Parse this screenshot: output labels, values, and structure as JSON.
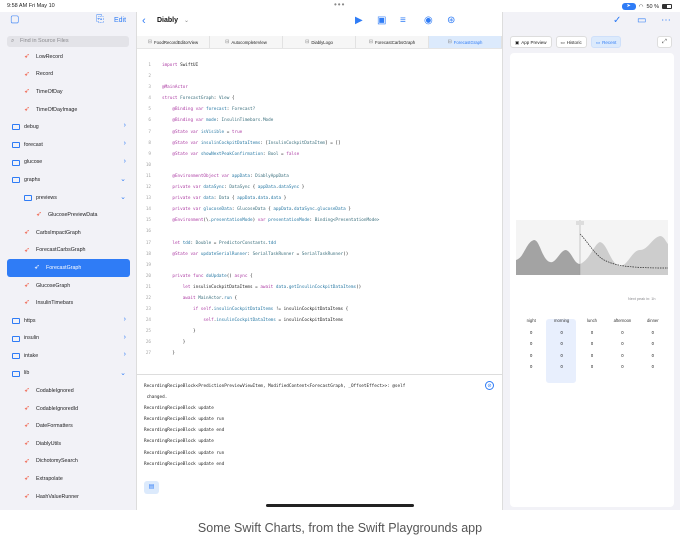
{
  "status_bar": {
    "time": "9:58 AM   Fri May 10",
    "battery": "50 %"
  },
  "sidebar": {
    "edit_label": "Edit",
    "search_placeholder": "Find in Source Files",
    "items": [
      {
        "label": "LowRecord",
        "type": "swift",
        "indent": 1
      },
      {
        "label": "Record",
        "type": "swift",
        "indent": 1
      },
      {
        "label": "TimeOfDay",
        "type": "swift",
        "indent": 1
      },
      {
        "label": "TimeOfDayImage",
        "type": "swift",
        "indent": 1
      },
      {
        "label": "debug",
        "type": "folder",
        "indent": 0,
        "chevron": "›"
      },
      {
        "label": "forecast",
        "type": "folder",
        "indent": 0,
        "chevron": "›"
      },
      {
        "label": "glucose",
        "type": "folder",
        "indent": 0,
        "chevron": "›"
      },
      {
        "label": "graphs",
        "type": "folder",
        "indent": 0,
        "chevron": "⌄"
      },
      {
        "label": "previews",
        "type": "folder",
        "indent": 1,
        "chevron": "⌄"
      },
      {
        "label": "GlucosePreviewData",
        "type": "swift",
        "indent": 2
      },
      {
        "label": "CarbsImpactGraph",
        "type": "swift",
        "indent": 1
      },
      {
        "label": "ForecastCarbsGraph",
        "type": "swift",
        "indent": 1
      },
      {
        "label": "ForecastGraph",
        "type": "swift",
        "indent": 1,
        "selected": true
      },
      {
        "label": "GlucoseGraph",
        "type": "swift",
        "indent": 1
      },
      {
        "label": "InsulinTimebars",
        "type": "swift",
        "indent": 1
      },
      {
        "label": "https",
        "type": "folder",
        "indent": 0,
        "chevron": "›"
      },
      {
        "label": "insulin",
        "type": "folder",
        "indent": 0,
        "chevron": "›"
      },
      {
        "label": "intake",
        "type": "folder",
        "indent": 0,
        "chevron": "›"
      },
      {
        "label": "lib",
        "type": "folder",
        "indent": 0,
        "chevron": "⌄"
      },
      {
        "label": "CodableIgnored",
        "type": "swift",
        "indent": 1
      },
      {
        "label": "CodableIgnoredId",
        "type": "swift",
        "indent": 1
      },
      {
        "label": "DateFormatters",
        "type": "swift",
        "indent": 1
      },
      {
        "label": "DiablyUtils",
        "type": "swift",
        "indent": 1
      },
      {
        "label": "DichotomySearch",
        "type": "swift",
        "indent": 1
      },
      {
        "label": "Extrapolate",
        "type": "swift",
        "indent": 1
      },
      {
        "label": "HashValueRunner",
        "type": "swift",
        "indent": 1
      },
      {
        "label": "JSONValue",
        "type": "swift",
        "indent": 1
      }
    ]
  },
  "editor": {
    "project_title": "Diably",
    "tabs": [
      {
        "label": "FoodRecordEditorView",
        "active": false
      },
      {
        "label": "AutocompleteView",
        "active": false
      },
      {
        "label": "DiablyLogo",
        "active": false
      },
      {
        "label": "ForecastCarbsGraph",
        "active": false
      },
      {
        "label": "ForecastGraph",
        "active": true
      }
    ],
    "code_lines": [
      {
        "n": "1",
        "html": "<span class='kw'>import</span> SwiftUI"
      },
      {
        "n": "2",
        "html": ""
      },
      {
        "n": "3",
        "html": "<span class='kw'>@MainActor</span>"
      },
      {
        "n": "4",
        "html": "<span class='kw'>struct</span> <span class='ty'>ForecastGraph</span>: <span class='ty'>View</span> {"
      },
      {
        "n": "5",
        "html": "    <span class='kw'>@Binding var</span> <span class='prop'>forecast</span>: <span class='ty'>Forecast?</span>"
      },
      {
        "n": "6",
        "html": "    <span class='kw'>@Binding var</span> <span class='prop'>mode</span>: <span class='ty'>InsulinTimebars.Mode</span>"
      },
      {
        "n": "7",
        "html": "    <span class='kw'>@State var</span> <span class='prop'>isVisible</span> = <span class='kw'>true</span>"
      },
      {
        "n": "8",
        "html": "    <span class='kw'>@State var</span> <span class='prop'>insulinCockpitDataItems</span>: [<span class='ty'>InsulinCockpitDataItem</span>] = []"
      },
      {
        "n": "9",
        "html": "    <span class='kw'>@State var</span> <span class='prop'>showNextPeakConfirmation</span>: <span class='ty'>Bool</span> = <span class='kw'>false</span>"
      },
      {
        "n": "10",
        "html": ""
      },
      {
        "n": "11",
        "html": "    <span class='kw'>@EnvironmentObject var</span> <span class='prop'>appData</span>: <span class='ty'>DiablyAppData</span>"
      },
      {
        "n": "12",
        "html": "    <span class='kw'>private var</span> <span class='prop'>dataSync</span>: <span class='ty'>DataSync</span> { <span class='prop'>appData</span>.<span class='prop'>dataSync</span> }"
      },
      {
        "n": "13",
        "html": "    <span class='kw'>private var</span> <span class='prop'>data</span>: <span class='ty'>Data</span> { <span class='prop'>appData</span>.<span class='prop'>data</span>.<span class='prop'>data</span> }"
      },
      {
        "n": "14",
        "html": "    <span class='kw'>private var</span> <span class='prop'>glucoseData</span>: <span class='ty'>GlucoseData</span> { <span class='prop'>appData</span>.<span class='prop'>dataSync</span>.<span class='prop'>glucoseData</span> }"
      },
      {
        "n": "15",
        "html": "    <span class='kw'>@Environment</span>(\\.<span class='prop'>presentationMode</span>) <span class='kw'>var</span> <span class='prop'>presentationMode</span>: <span class='ty'>Binding&lt;PresentationMode&gt;</span>"
      },
      {
        "n": "16",
        "html": ""
      },
      {
        "n": "17",
        "html": "    <span class='kw'>let</span> <span class='prop'>tdd</span>: <span class='ty'>Double</span> = <span class='ty'>PredictorConstants</span>.<span class='prop'>tdd</span>"
      },
      {
        "n": "18",
        "html": "    <span class='kw'>@State var</span> <span class='prop'>updateSerialRunner</span>: <span class='ty'>SerialTaskRunner</span> = <span class='ty'>SerialTaskRunner</span>()"
      },
      {
        "n": "19",
        "html": ""
      },
      {
        "n": "20",
        "html": "    <span class='kw'>private func</span> <span class='prop'>doUpdate</span>() <span class='kw'>async</span> {"
      },
      {
        "n": "21",
        "html": "        <span class='kw'>let</span> insulinCockpitDataItems = <span class='kw'>await</span> <span class='prop'>data</span>.<span class='prop'>getInsulinCockpitDataItems</span>()"
      },
      {
        "n": "22",
        "html": "        <span class='kw'>await</span> <span class='ty'>MainActor</span>.<span class='prop'>run</span> {"
      },
      {
        "n": "23",
        "html": "            <span class='kw'>if self</span>.<span class='prop'>insulinCockpitDataItems</span> != insulinCockpitDataItems {"
      },
      {
        "n": "24",
        "html": "                <span class='kw'>self</span>.<span class='prop'>insulinCockpitDataItems</span> = insulinCockpitDataItems"
      },
      {
        "n": "25",
        "html": "            }"
      },
      {
        "n": "26",
        "html": "        }"
      },
      {
        "n": "27",
        "html": "    }"
      }
    ],
    "console_lines": [
      "RecordingRecipeBlock<PredictionPreviewViewItem, ModifiedContent<ForecastGraph, _OffsetEffect>>: @self",
      " changed.",
      "RecordingRecipeBlock update",
      "RecordingRecipeBlock update run",
      "RecordingRecipeBlock update end",
      "RecordingRecipeBlock update",
      "RecordingRecipeBlock update run",
      "RecordingRecipeBlock update end"
    ]
  },
  "preview": {
    "tabs": [
      {
        "label": "App Preview",
        "active": false
      },
      {
        "label": "Historic",
        "active": false
      },
      {
        "label": "Recent",
        "active": true
      }
    ],
    "next_peak_label": "Next peak in: 1h",
    "grid_headers": [
      "night",
      "morning",
      "lunch",
      "afternoon",
      "dinner"
    ],
    "grid_rows": [
      [
        "0",
        "0",
        "0",
        "0",
        "0"
      ],
      [
        "0",
        "0",
        "0",
        "0",
        "0"
      ],
      [
        "0",
        "0",
        "0",
        "0",
        "0"
      ],
      [
        "0",
        "0",
        "0",
        "0",
        "0"
      ]
    ],
    "accent": "#2f7cf6"
  },
  "caption": "Some Swift Charts, from the Swift Playgrounds app"
}
